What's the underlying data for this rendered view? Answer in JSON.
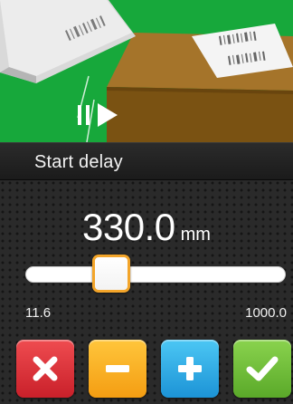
{
  "title": "Start delay",
  "value": {
    "number": "330.0",
    "unit": "mm"
  },
  "slider": {
    "min_label": "11.6",
    "max_label": "1000.0",
    "min": 11.6,
    "max": 1000.0,
    "current": 330.0
  },
  "buttons": {
    "cancel_icon": "close-icon",
    "decrease_icon": "minus-icon",
    "increase_icon": "plus-icon",
    "confirm_icon": "check-icon"
  },
  "colors": {
    "cancel": "#d9303a",
    "decrease": "#f7ad1f",
    "increase": "#2aa9e6",
    "confirm": "#6cbc35",
    "thumb_border": "#f3a52a",
    "illustration_background": "#19a83c"
  }
}
